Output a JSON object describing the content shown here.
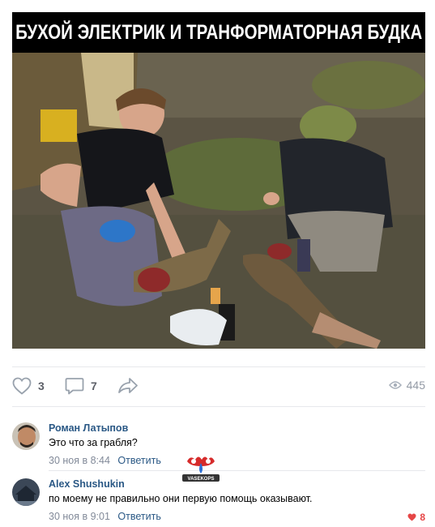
{
  "post": {
    "image_caption": "БУХОЙ ЭЛЕКТРИК И ТРАНФОРМАТОРНАЯ БУДКА"
  },
  "actions": {
    "likes_count": "3",
    "comments_count": "7",
    "views_count": "445",
    "like_icon": "heart-outline-icon",
    "comment_icon": "comment-bubble-icon",
    "share_icon": "share-arrow-icon",
    "views_icon": "eye-icon"
  },
  "comments": [
    {
      "author": "Роман Латыпов",
      "text": "Это что за грабля?",
      "date": "30 ноя в 8:44",
      "reply_label": "Ответить"
    },
    {
      "author": "Alex Shushukin",
      "text": "по моему не правильно они первую помощь оказывают.",
      "date": "30 ноя в 9:01",
      "reply_label": "Ответить",
      "likes": "8"
    }
  ],
  "watermark": {
    "label": "VASEKOPS"
  },
  "colors": {
    "link": "#2a5885",
    "meta": "#828a99",
    "like_red": "#e64646",
    "divider": "#e7e8ec"
  }
}
